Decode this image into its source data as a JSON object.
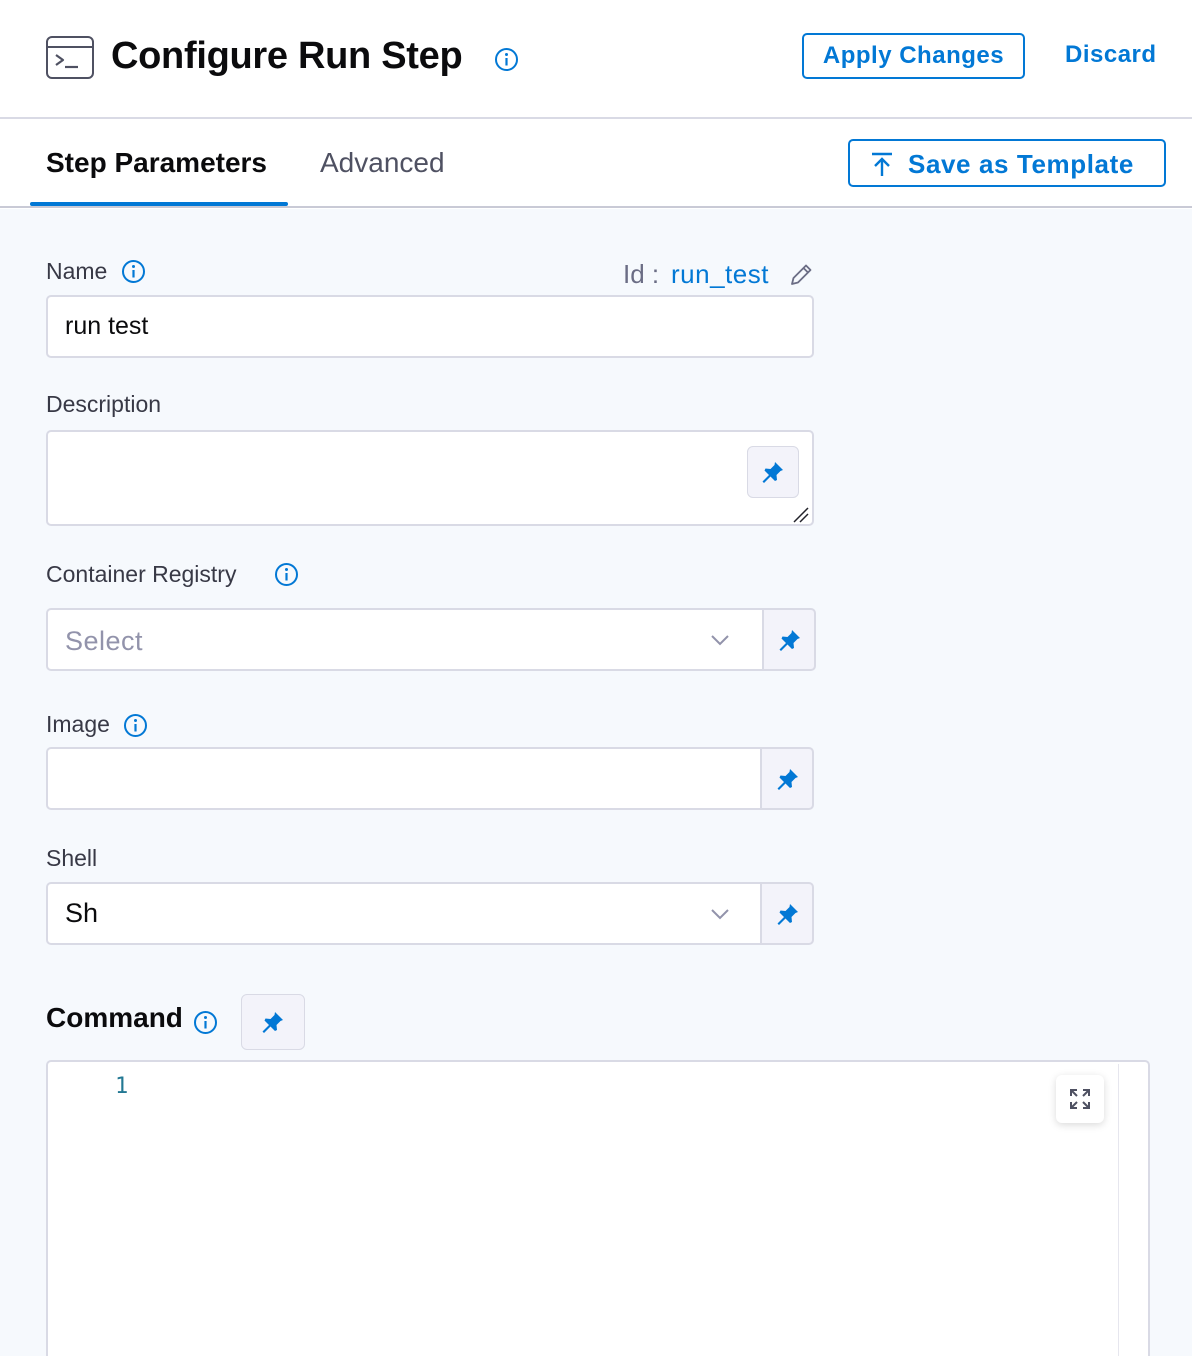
{
  "header": {
    "title": "Configure Run Step",
    "apply_label": "Apply Changes",
    "discard_label": "Discard"
  },
  "tabs": [
    {
      "label": "Step Parameters",
      "active": true
    },
    {
      "label": "Advanced",
      "active": false
    }
  ],
  "save_template_label": "Save as Template",
  "form": {
    "name_label": "Name",
    "name_value": "run test",
    "id_label": "Id :",
    "id_value": "run_test",
    "description_label": "Description",
    "description_value": "",
    "registry_label": "Container Registry",
    "registry_placeholder": "Select",
    "image_label": "Image",
    "image_value": "",
    "shell_label": "Shell",
    "shell_value": "Sh",
    "command_label": "Command"
  },
  "editor": {
    "line_numbers": [
      "1"
    ]
  },
  "colors": {
    "accent": "#0278d5",
    "content_bg": "#f6f9fd",
    "border": "#d9dae5"
  },
  "icons": [
    "terminal-icon",
    "info-icon",
    "upload-icon",
    "edit-icon",
    "pin-icon",
    "chevron-down-icon",
    "expand-icon",
    "resize-grip-icon"
  ]
}
